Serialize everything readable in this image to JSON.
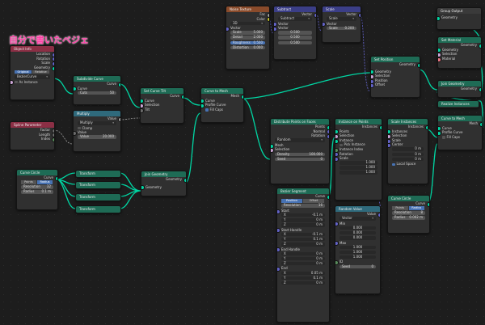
{
  "title": "自分で書いたベジェ",
  "colors": {
    "geometry": "#00d6a3",
    "float": "#a1a1a1",
    "vector": "#6363c7",
    "bool": "#cca6d6"
  },
  "nodes": {
    "object_info": {
      "title": "Object Info",
      "rows": [
        "Location",
        "Rotation",
        "Scale",
        "Geometry"
      ],
      "mode_a": "Original",
      "mode_b": "Relative",
      "object": "BezierCurve",
      "as_instance": "As Instance"
    },
    "spline_param": {
      "title": "Spline Parameter",
      "rows": [
        "Factor",
        "Length",
        "Index"
      ]
    },
    "curve_circle": {
      "title": "Curve Circle",
      "out": "Curve",
      "mode_a": "Points",
      "mode_b": "Radius",
      "res_label": "Resolution",
      "res_val": "32",
      "rad_label": "Radius",
      "rad_val": "0.1 m"
    },
    "subdivide": {
      "title": "Subdivide Curve",
      "out": "Curve",
      "in": "Curve",
      "cuts_label": "Cuts",
      "cuts_val": "50"
    },
    "multiply": {
      "title": "Multiply",
      "out": "Value",
      "op": "Multiply",
      "clamp": "Clamp",
      "in": "Value",
      "val_label": "Value",
      "val": "20.000"
    },
    "set_tilt": {
      "title": "Set Curve Tilt",
      "out": "Curve",
      "in": "Curve",
      "sel": "Selection",
      "tilt": "Tilt"
    },
    "transforms": {
      "t1": "Transform",
      "t2": "Transform",
      "t3": "Transform",
      "t4": "Transform"
    },
    "join_geo": {
      "title": "Join Geometry",
      "out": "Geometry",
      "in": "Geometry"
    },
    "curve_to_mesh": {
      "title": "Curve to Mesh",
      "out": "Mesh",
      "curve": "Curve",
      "profile": "Profile Curve",
      "fill": "Fill Caps"
    },
    "noise": {
      "title": "Noise Texture",
      "fac": "Fac",
      "color": "Color",
      "dim": "3D",
      "vector": "Vector",
      "scale_l": "Scale",
      "scale_v": "5.000",
      "detail_l": "Detail",
      "detail_v": "2.000",
      "rough_l": "Roughness",
      "rough_v": "0.500",
      "dist_l": "Distortion",
      "dist_v": "0.000"
    },
    "subtract": {
      "title": "Subtract",
      "out": "Vector",
      "op": "Subtract",
      "v1": "Vector",
      "v2": "Vector",
      "x": "0.500",
      "y": "0.500",
      "z": "0.500"
    },
    "scale": {
      "title": "Scale",
      "out": "Vector",
      "op": "Scale",
      "vec": "Vector",
      "scale_l": "Scale",
      "scale_v": "0.200"
    },
    "set_position": {
      "title": "Set Position",
      "out": "Geometry",
      "geo": "Geometry",
      "sel": "Selection",
      "pos": "Position",
      "off": "Offset"
    },
    "distribute": {
      "title": "Distribute Points on Faces",
      "points": "Points",
      "normal": "Normal",
      "rotation": "Rotation",
      "mode": "Random",
      "mesh": "Mesh",
      "sel": "Selection",
      "dens_l": "Density",
      "dens_v": "100.000",
      "seed_l": "Seed",
      "seed_v": "0"
    },
    "instance_on_points": {
      "title": "Instance on Points",
      "out": "Instances",
      "points": "Points",
      "sel": "Selection",
      "instance": "Instance",
      "pick": "Pick Instance",
      "idx": "Instance Index",
      "rot": "Rotation",
      "scale": "Scale",
      "x": "1.000",
      "y": "1.000",
      "z": "1.000"
    },
    "scale_instances": {
      "title": "Scale Instances",
      "out": "Instances",
      "inst": "Instances",
      "sel": "Selection",
      "scale": "Scale",
      "center": "Center",
      "x": "0 m",
      "y": "0 m",
      "z": "0 m",
      "local": "Local Space"
    },
    "curve_to_mesh2": {
      "title": "Curve to Mesh",
      "out": "Mesh",
      "curve": "Curve",
      "profile": "Profile Curve",
      "fill": "Fill Caps"
    },
    "bezier": {
      "title": "Bezier Segment",
      "out": "Curve",
      "mode_a": "Position",
      "mode_b": "Offset",
      "res_l": "Resolution",
      "res_v": "16",
      "start": "Start",
      "sx": "-0.1 m",
      "sy": "0 m",
      "sz": "0 m",
      "sh": "Start Handle",
      "shx": "-0.1 m",
      "shy": "0.1 m",
      "shz": "0 m",
      "eh": "End Handle",
      "ehx": "0 m",
      "ehy": "0 m",
      "ehz": "0 m",
      "end": "End",
      "ex": "0.05 m",
      "ey": "0.1 m",
      "ez": "0 m"
    },
    "random_value": {
      "title": "Random Value",
      "out": "Value",
      "type": "Vector",
      "min": "Min",
      "min_x": "0.000",
      "min_y": "0.000",
      "min_z": "0.000",
      "max": "Max",
      "max_x": "1.000",
      "max_y": "1.000",
      "max_z": "1.000",
      "id": "ID",
      "seed_l": "Seed",
      "seed_v": "0"
    },
    "curve_circle2": {
      "title": "Curve Circle",
      "out": "Curve",
      "mode_a": "Points",
      "mode_b": "Radius",
      "res_l": "Resolution",
      "res_v": "8",
      "rad_l": "Radius",
      "rad_v": "0.002 m"
    },
    "group_output": {
      "title": "Group Output",
      "geo": "Geometry"
    },
    "set_material": {
      "title": "Set Material",
      "out": "Geometry",
      "geo": "Geometry",
      "sel": "Selection",
      "mat": "Material"
    },
    "join_geo2": {
      "title": "Join Geometry",
      "out": "Geometry",
      "in": "Geometry"
    },
    "realize": {
      "title": "Realize Instances"
    }
  }
}
